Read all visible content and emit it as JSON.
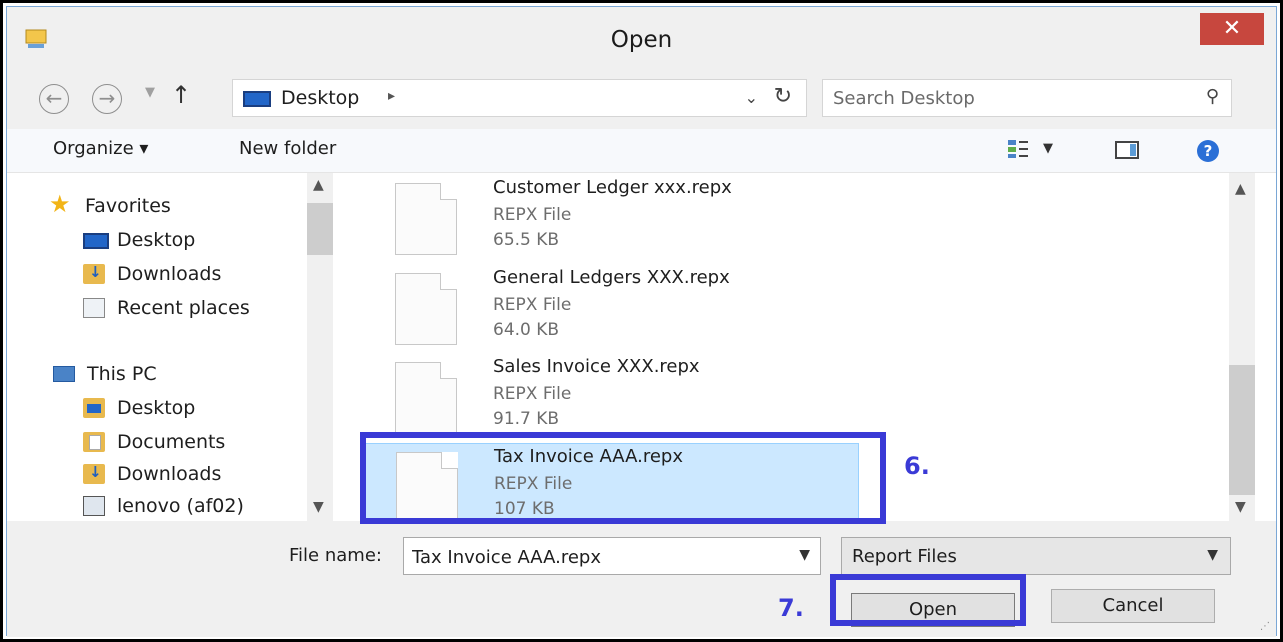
{
  "window": {
    "title": "Open",
    "close_glyph": "✕"
  },
  "address": {
    "location": "Desktop",
    "search_placeholder": "Search Desktop"
  },
  "toolbar": {
    "organize_label": "Organize ▾",
    "new_folder_label": "New folder"
  },
  "nav_pane": {
    "items": [
      {
        "label": "Favorites",
        "icon": "star-icon"
      },
      {
        "label": "Desktop",
        "icon": "desktop-icon"
      },
      {
        "label": "Downloads",
        "icon": "downloads-folder-icon"
      },
      {
        "label": "Recent places",
        "icon": "recent-places-icon"
      },
      {
        "label": "This PC",
        "icon": "computer-icon"
      },
      {
        "label": "Desktop",
        "icon": "desktop-folder-icon"
      },
      {
        "label": "Documents",
        "icon": "documents-folder-icon"
      },
      {
        "label": "Downloads",
        "icon": "downloads-folder-icon"
      },
      {
        "label": "lenovo (af02)",
        "icon": "network-drive-icon"
      }
    ]
  },
  "files": [
    {
      "name": "Customer Ledger xxx.repx",
      "type": "REPX File",
      "size": "65.5 KB",
      "selected": false
    },
    {
      "name": "General Ledgers XXX.repx",
      "type": "REPX File",
      "size": "64.0 KB",
      "selected": false
    },
    {
      "name": "Sales Invoice XXX.repx",
      "type": "REPX File",
      "size": "91.7 KB",
      "selected": false
    },
    {
      "name": "Tax Invoice AAA.repx",
      "type": "REPX File",
      "size": "107 KB",
      "selected": true
    }
  ],
  "bottom": {
    "filename_label": "File name:",
    "filename_value": "Tax Invoice AAA.repx",
    "filetype_value": "Report Files",
    "open_label": "Open",
    "cancel_label": "Cancel"
  },
  "annotations": {
    "step_file": "6.",
    "step_open": "7.",
    "color": "#3a3ad6"
  },
  "colors": {
    "selection": "#cce8ff",
    "close_button": "#c7473e"
  }
}
